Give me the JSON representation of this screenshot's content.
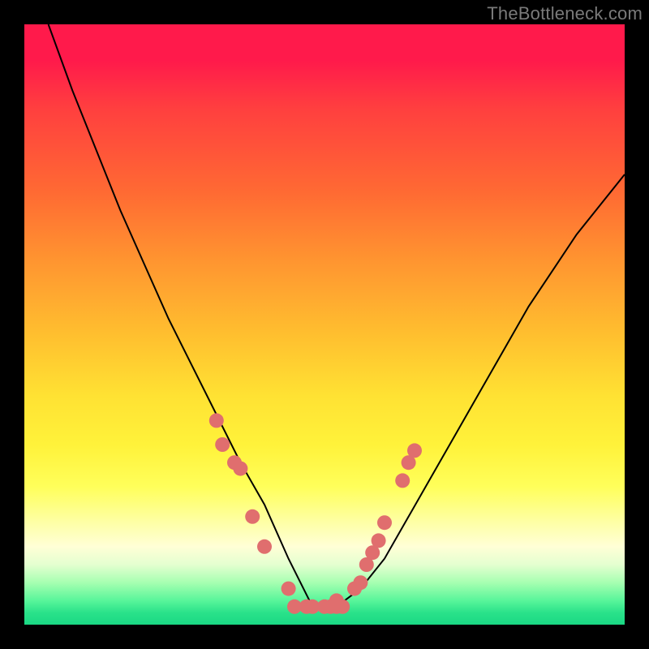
{
  "watermark": "TheBottleneck.com",
  "chart_data": {
    "type": "line",
    "title": "",
    "xlabel": "",
    "ylabel": "",
    "xlim": [
      0,
      100
    ],
    "ylim": [
      0,
      100
    ],
    "curve": {
      "name": "bottleneck-curve",
      "description": "V-shaped bottleneck percentage curve; minimum near x≈48",
      "x": [
        4,
        8,
        12,
        16,
        20,
        24,
        28,
        32,
        36,
        40,
        44,
        48,
        52,
        56,
        60,
        64,
        68,
        72,
        76,
        80,
        84,
        88,
        92,
        96,
        100
      ],
      "y": [
        100,
        89,
        79,
        69,
        60,
        51,
        43,
        35,
        27,
        20,
        11,
        3,
        3,
        6,
        11,
        18,
        25,
        32,
        39,
        46,
        53,
        59,
        65,
        70,
        75
      ]
    },
    "series": [
      {
        "name": "data-points-left",
        "type": "scatter",
        "x": [
          32,
          33,
          35,
          36,
          38,
          40,
          44
        ],
        "y": [
          34,
          30,
          27,
          26,
          18,
          13,
          6
        ]
      },
      {
        "name": "data-points-right",
        "type": "scatter",
        "x": [
          52,
          55,
          56,
          57,
          58,
          59,
          60,
          63,
          64,
          65
        ],
        "y": [
          4,
          6,
          7,
          10,
          12,
          14,
          17,
          24,
          27,
          29
        ]
      },
      {
        "name": "data-points-bottom",
        "type": "scatter",
        "x": [
          45,
          47,
          48,
          50,
          51,
          52,
          53
        ],
        "y": [
          3,
          3,
          3,
          3,
          3,
          3,
          3
        ]
      }
    ],
    "background": "rainbow-gradient-vertical",
    "legend": false,
    "grid": false
  }
}
